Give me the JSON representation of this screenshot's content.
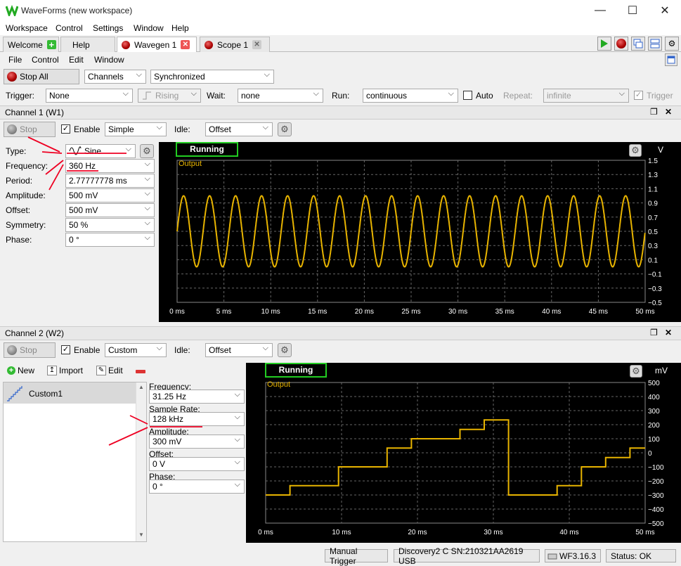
{
  "window": {
    "title": "WaveForms (new workspace)",
    "minimize": "—",
    "maximize": "☐",
    "close": "✕"
  },
  "menu": [
    "Workspace",
    "Control",
    "Settings",
    "Window",
    "Help"
  ],
  "tabs": [
    {
      "label": "Welcome"
    },
    {
      "label": "Help"
    },
    {
      "label": "Wavegen 1"
    },
    {
      "label": "Scope 1"
    }
  ],
  "submenu": [
    "File",
    "Control",
    "Edit",
    "Window"
  ],
  "toolbar": {
    "stop_all": "Stop All",
    "channels": "Channels",
    "mode": "Synchronized"
  },
  "trigger": {
    "trigger_label": "Trigger:",
    "trigger_value": "None",
    "edge": "Rising",
    "wait_label": "Wait:",
    "wait_value": "none",
    "run_label": "Run:",
    "run_value": "continuous",
    "auto_label": "Auto",
    "repeat_label": "Repeat:",
    "repeat_value": "infinite",
    "trigger_chk_label": "Trigger"
  },
  "ch1": {
    "header": "Channel 1 (W1)",
    "stop": "Stop",
    "enable": "Enable",
    "mode": "Simple",
    "idle_label": "Idle:",
    "idle_value": "Offset",
    "params": [
      {
        "label": "Type:",
        "value": "Sine"
      },
      {
        "label": "Frequency:",
        "value": "360 Hz"
      },
      {
        "label": "Period:",
        "value": "2.77777778 ms"
      },
      {
        "label": "Amplitude:",
        "value": "500 mV"
      },
      {
        "label": "Offset:",
        "value": "500 mV"
      },
      {
        "label": "Symmetry:",
        "value": "50 %"
      },
      {
        "label": "Phase:",
        "value": "0 °"
      }
    ],
    "plot": {
      "status": "Running",
      "trace_label": "Output",
      "unit": "V",
      "yticks": [
        "1.5",
        "1.3",
        "1.1",
        "0.9",
        "0.7",
        "0.5",
        "0.3",
        "0.1",
        "−0.1",
        "−0.3",
        "−0.5"
      ],
      "xticks": [
        "0 ms",
        "5 ms",
        "10 ms",
        "15 ms",
        "20 ms",
        "25 ms",
        "30 ms",
        "35 ms",
        "40 ms",
        "45 ms",
        "50 ms"
      ],
      "trace_color": "#e8b400"
    }
  },
  "ch2": {
    "header": "Channel 2 (W2)",
    "stop": "Stop",
    "enable": "Enable",
    "mode": "Custom",
    "idle_label": "Idle:",
    "idle_value": "Offset",
    "new": "New",
    "import": "Import",
    "edit": "Edit",
    "custom_item": "Custom1",
    "params": [
      {
        "label": "Frequency:",
        "value": "31.25 Hz"
      },
      {
        "label": "Sample Rate:",
        "value": "128 kHz"
      },
      {
        "label": "Amplitude:",
        "value": "300 mV"
      },
      {
        "label": "Offset:",
        "value": "0 V"
      },
      {
        "label": "Phase:",
        "value": "0 °"
      }
    ],
    "plot": {
      "status": "Running",
      "trace_label": "Output",
      "unit": "mV",
      "yticks": [
        "500",
        "400",
        "300",
        "200",
        "100",
        "0",
        "−100",
        "−200",
        "−300",
        "−400",
        "−500"
      ],
      "xticks": [
        "0 ms",
        "10 ms",
        "20 ms",
        "30 ms",
        "40 ms",
        "50 ms"
      ],
      "trace_color": "#e8b400"
    }
  },
  "statusbar": {
    "manual": "Manual Trigger",
    "device": "Discovery2 C SN:210321AA2619 USB",
    "version": "WF3.16.3",
    "status": "Status: OK"
  },
  "chart_data": [
    {
      "type": "line",
      "title": "",
      "xlabel": "",
      "ylabel": "V",
      "series": [
        {
          "name": "Output",
          "waveform": "sine",
          "frequency_hz": 360,
          "amplitude_v": 0.5,
          "offset_v": 0.5
        }
      ],
      "xlim": [
        0,
        50
      ],
      "ylim": [
        -0.5,
        1.5
      ]
    },
    {
      "type": "line",
      "title": "",
      "xlabel": "",
      "ylabel": "mV",
      "series": [
        {
          "name": "Output",
          "waveform": "staircase",
          "frequency_hz": 31.25,
          "amplitude_mv": 300,
          "offset_mv": 0,
          "steps": 10
        }
      ],
      "xlim": [
        0,
        50
      ],
      "ylim": [
        -500,
        500
      ]
    }
  ]
}
